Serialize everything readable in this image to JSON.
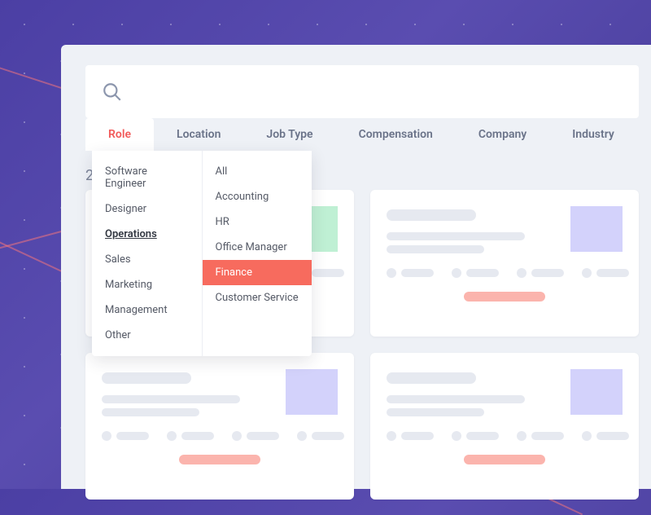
{
  "tabs": {
    "role": "Role",
    "location": "Location",
    "jobtype": "Job Type",
    "compensation": "Compensation",
    "company": "Company",
    "industry": "Industry"
  },
  "results_count_prefix": "2",
  "dropdown": {
    "col1": {
      "software_engineer": "Software Engineer",
      "designer": "Designer",
      "operations": "Operations",
      "sales": "Sales",
      "marketing": "Marketing",
      "management": "Management",
      "other": "Other"
    },
    "col2": {
      "all": "All",
      "accounting": "Accounting",
      "hr": "HR",
      "office_manager": "Office Manager",
      "finance": "Finance",
      "customer_service": "Customer Service"
    }
  },
  "colors": {
    "accent_active": "#f25a5a",
    "accent_hover": "#f76b5e",
    "skeleton": "#e6e9f0",
    "cta_pill": "#fbb4ad",
    "thumb_green": "#bff0d4",
    "thumb_lavender": "#d3d2fb"
  }
}
